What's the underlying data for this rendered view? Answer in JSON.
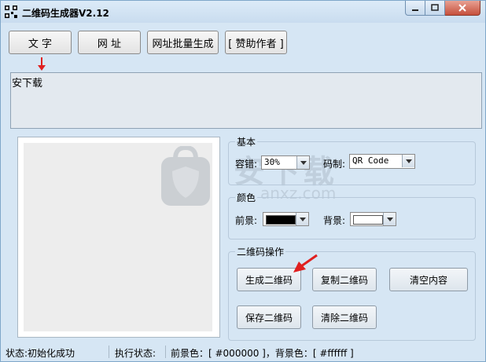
{
  "window": {
    "title": "二维码生成器V2.12"
  },
  "toolbar": {
    "text_label": "文  字",
    "url_label": "网  址",
    "batch_label": "网址批量生成",
    "donate_label": "[ 赞助作者 ]"
  },
  "input": {
    "value": "安下载"
  },
  "basic": {
    "title": "基本",
    "error_label": "容错:",
    "error_value": "30%",
    "code_label": "码制:",
    "code_value": "QR Code"
  },
  "color": {
    "title": "颜色",
    "fore_label": "前景:",
    "fore_color": "#000000",
    "back_label": "背景:",
    "back_color": "#ffffff"
  },
  "ops": {
    "title": "二维码操作",
    "generate": "生成二维码",
    "copy": "复制二维码",
    "clear_content": "清空内容",
    "save": "保存二维码",
    "clear_qr": "清除二维码"
  },
  "watermark": {
    "text": "安下载",
    "sub": "anxz.com"
  },
  "status": {
    "state": "状态:初始化成功",
    "exec": "执行状态:",
    "colors": "前景色：[ #000000 ]，背景色：[ #ffffff ]"
  }
}
